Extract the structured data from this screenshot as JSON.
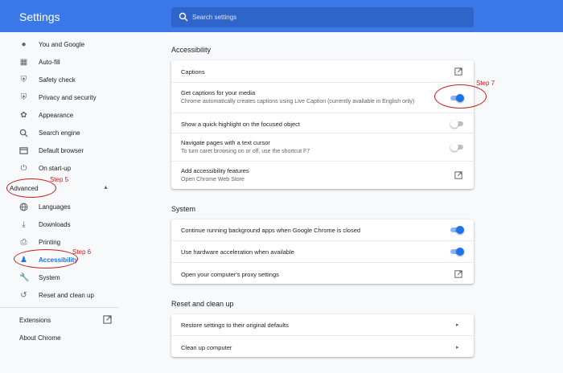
{
  "header": {
    "title": "Settings",
    "search_placeholder": "Search settings"
  },
  "sidebar": {
    "items": [
      {
        "label": "You and Google",
        "icon": "person-icon"
      },
      {
        "label": "Auto-fill",
        "icon": "clipboard-icon"
      },
      {
        "label": "Safety check",
        "icon": "shield-check-icon"
      },
      {
        "label": "Privacy and security",
        "icon": "shield-icon"
      },
      {
        "label": "Appearance",
        "icon": "palette-icon"
      },
      {
        "label": "Search engine",
        "icon": "search-icon"
      },
      {
        "label": "Default browser",
        "icon": "browser-icon"
      },
      {
        "label": "On start-up",
        "icon": "power-icon"
      }
    ],
    "advanced_label": "Advanced",
    "advanced_items": [
      {
        "label": "Languages",
        "icon": "globe-icon"
      },
      {
        "label": "Downloads",
        "icon": "download-icon"
      },
      {
        "label": "Printing",
        "icon": "printer-icon"
      },
      {
        "label": "Accessibility",
        "icon": "accessibility-icon",
        "active": true
      },
      {
        "label": "System",
        "icon": "wrench-icon"
      },
      {
        "label": "Reset and clean up",
        "icon": "history-icon"
      }
    ],
    "extensions_label": "Extensions",
    "about_label": "About Chrome"
  },
  "accessibility": {
    "title": "Accessibility",
    "captions": "Captions",
    "live_caption_title": "Get captions for your media",
    "live_caption_sub": "Chrome automatically creates captions using Live Caption (currently available in English only)",
    "live_caption_on": true,
    "focus_highlight": "Show a quick highlight on the focused object",
    "focus_highlight_on": false,
    "caret_title": "Navigate pages with a text cursor",
    "caret_sub": "To turn caret browsing on or off, use the shortcut F7",
    "caret_on": false,
    "add_features_title": "Add accessibility features",
    "add_features_sub": "Open Chrome Web Store"
  },
  "system": {
    "title": "System",
    "background_apps": "Continue running background apps when Google Chrome is closed",
    "background_apps_on": true,
    "hw_accel": "Use hardware acceleration when available",
    "hw_accel_on": true,
    "proxy": "Open your computer's proxy settings"
  },
  "reset": {
    "title": "Reset and clean up",
    "restore": "Restore settings to their original defaults",
    "cleanup": "Clean up computer"
  },
  "annotations": {
    "step5": "Step 5",
    "step6": "Step 6",
    "step7": "Step 7",
    "color": "#c5221f"
  },
  "colors": {
    "header": "#3b78e7",
    "accent": "#1a73e8"
  }
}
